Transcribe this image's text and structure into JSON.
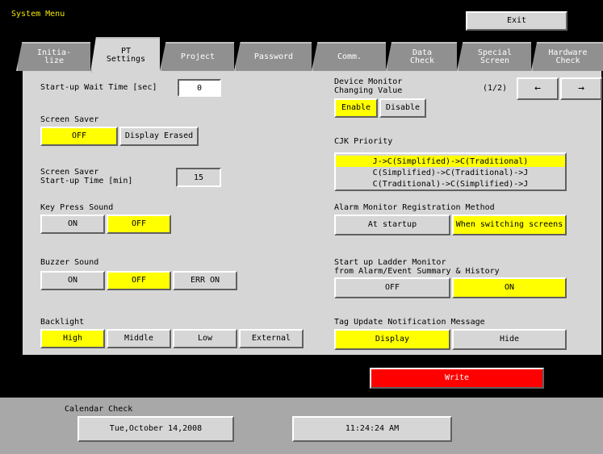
{
  "window": {
    "title": "System Menu",
    "exit_label": "Exit"
  },
  "tabs": [
    {
      "label": "Initia-\nlize",
      "active": false
    },
    {
      "label": "PT\nSettings",
      "active": true
    },
    {
      "label": "Project",
      "active": false
    },
    {
      "label": "Password",
      "active": false
    },
    {
      "label": "Comm.",
      "active": false
    },
    {
      "label": "Data\nCheck",
      "active": false
    },
    {
      "label": "Special\nScreen",
      "active": false
    },
    {
      "label": "Hardware\nCheck",
      "active": false
    }
  ],
  "startup_wait": {
    "label": "Start-up Wait Time [sec]",
    "value": "0"
  },
  "screen_saver": {
    "label": "Screen Saver",
    "options": [
      "OFF",
      "Display Erased"
    ],
    "selected": "OFF"
  },
  "screen_saver_time": {
    "label": "Screen Saver\nStart-up Time [min]",
    "value": "15"
  },
  "key_press_sound": {
    "label": "Key Press Sound",
    "options": [
      "ON",
      "OFF"
    ],
    "selected": "OFF"
  },
  "buzzer_sound": {
    "label": "Buzzer Sound",
    "options": [
      "ON",
      "OFF",
      "ERR ON"
    ],
    "selected": "OFF"
  },
  "backlight": {
    "label": "Backlight",
    "options": [
      "High",
      "Middle",
      "Low",
      "External"
    ],
    "selected": "High"
  },
  "device_monitor": {
    "label": "Device Monitor\nChanging Value",
    "options": [
      "Enable",
      "Disable"
    ],
    "selected": "Enable"
  },
  "pager": {
    "label": "(1/2)",
    "prev": "←",
    "next": "→"
  },
  "cjk_priority": {
    "label": "CJK Priority",
    "options": [
      "J->C(Simplified)->C(Traditional)",
      "C(Simplified)->C(Traditional)->J",
      "C(Traditional)->C(Simplified)->J"
    ],
    "selected": "J->C(Simplified)->C(Traditional)"
  },
  "alarm_monitor": {
    "label": "Alarm Monitor Registration Method",
    "options": [
      "At startup",
      "When switching screens"
    ],
    "selected": "When switching screens"
  },
  "ladder_monitor": {
    "label": "Start up Ladder Monitor\nfrom Alarm/Event Summary & History",
    "options": [
      "OFF",
      "ON"
    ],
    "selected": "ON"
  },
  "tag_update": {
    "label": "Tag Update Notification Message",
    "options": [
      "Display",
      "Hide"
    ],
    "selected": "Display"
  },
  "write_label": "Write",
  "calendar": {
    "label": "Calendar Check",
    "date": "Tue,October 14,2008",
    "time": "11:24:24 AM"
  },
  "colors": {
    "selected": "#ffff00",
    "button": "#d6d6d6",
    "write": "#ff0000",
    "title": "#f0e800"
  }
}
